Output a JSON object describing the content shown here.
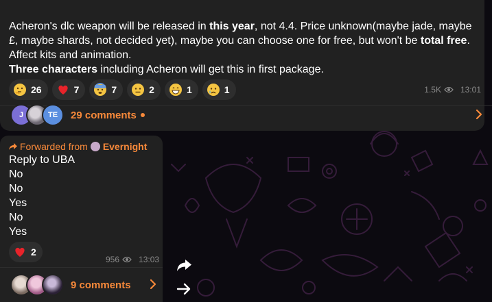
{
  "channel_post": {
    "text_segments": [
      {
        "text": "Acheron's dlc weapon will be released in ",
        "bold": false
      },
      {
        "text": "this year",
        "bold": true
      },
      {
        "text": ", not 4.4. Price unknown(maybe jade, maybe £, maybe shards, not decided yet), maybe you can choose one for free, but won't be ",
        "bold": false
      },
      {
        "text": "total free",
        "bold": true
      },
      {
        "text": ". Affect kits and animation.",
        "bold": false
      }
    ],
    "line2_bold": "Three characters",
    "line2_rest": " including Acheron will get this in first package.",
    "reactions": [
      {
        "emoji": "thinking-face",
        "count": "26"
      },
      {
        "emoji": "red-heart",
        "count": "7"
      },
      {
        "emoji": "anxious-face",
        "count": "7"
      },
      {
        "emoji": "neutral-face",
        "count": "2"
      },
      {
        "emoji": "grinning-face",
        "count": "1"
      },
      {
        "emoji": "crying-face",
        "count": "1"
      }
    ],
    "views": "1.5K",
    "time": "13:01",
    "commenters": [
      "J",
      "",
      "TE"
    ],
    "comments_label": "29 comments"
  },
  "forwarded_post": {
    "forwarded_prefix": "Forwarded from",
    "forwarded_from": "Evernight",
    "lines": [
      "Reply to UBA",
      "No",
      "No",
      "Yes",
      "No",
      "Yes"
    ],
    "reactions": [
      {
        "emoji": "red-heart",
        "count": "2"
      }
    ],
    "views": "956",
    "time": "13:03",
    "comments_label": "9 comments"
  },
  "colors": {
    "accent": "#f7893a",
    "bubble": "#212121",
    "background": "#0c0a10",
    "avatar_j": "#7b6fd6",
    "avatar_te": "#5b8fe0"
  }
}
